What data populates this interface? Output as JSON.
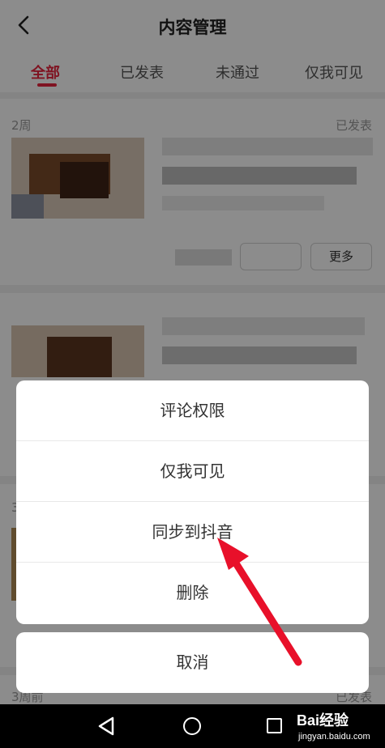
{
  "header": {
    "title": "内容管理"
  },
  "tabs": [
    {
      "label": "全部",
      "active": true
    },
    {
      "label": "已发表",
      "active": false
    },
    {
      "label": "未通过",
      "active": false
    },
    {
      "label": "仅我可见",
      "active": false
    }
  ],
  "posts": [
    {
      "time": "2周",
      "status": "已发表",
      "more_label": "更多"
    },
    {
      "time": "3",
      "status": ""
    },
    {
      "time": "3周前",
      "status": "已发表"
    }
  ],
  "action_sheet": {
    "items": [
      "评论权限",
      "仅我可见",
      "同步到抖音",
      "删除"
    ],
    "cancel_label": "取消"
  },
  "watermark": {
    "brand": "Bai经验",
    "url": "jingyan.baidu.com"
  },
  "colors": {
    "accent": "#e8233c",
    "arrow": "#e8102a",
    "overlay": "rgba(0,0,0,0.45)"
  }
}
